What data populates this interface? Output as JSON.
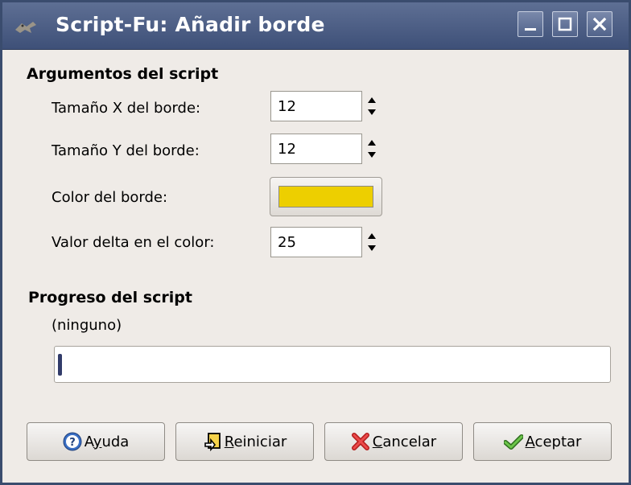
{
  "window": {
    "title": "Script-Fu: Añadir borde"
  },
  "arguments": {
    "section_title": "Argumentos del script",
    "border_x_label": "Tamaño X del borde:",
    "border_x_value": "12",
    "border_y_label": "Tamaño Y del borde:",
    "border_y_value": "12",
    "color_label": "Color del borde:",
    "color_value": "#edcf00",
    "delta_label": "Valor delta en el color:",
    "delta_value": "25"
  },
  "progress": {
    "section_title": "Progreso del script",
    "status": "(ninguno)"
  },
  "buttons": {
    "help": {
      "first": "A",
      "mnemonic": "y",
      "rest": "uda"
    },
    "reset": {
      "first": "",
      "mnemonic": "R",
      "rest": "einiciar"
    },
    "cancel": {
      "first": "",
      "mnemonic": "C",
      "rest": "ancelar"
    },
    "ok": {
      "first": "",
      "mnemonic": "A",
      "rest": "ceptar"
    }
  },
  "icons": {
    "app": "gimp-wilber-icon",
    "minimize": "minimize-icon",
    "maximize": "maximize-icon",
    "close": "close-icon",
    "help": "help-icon",
    "reset": "reset-icon",
    "cancel": "cancel-icon",
    "ok": "checkmark-icon"
  }
}
